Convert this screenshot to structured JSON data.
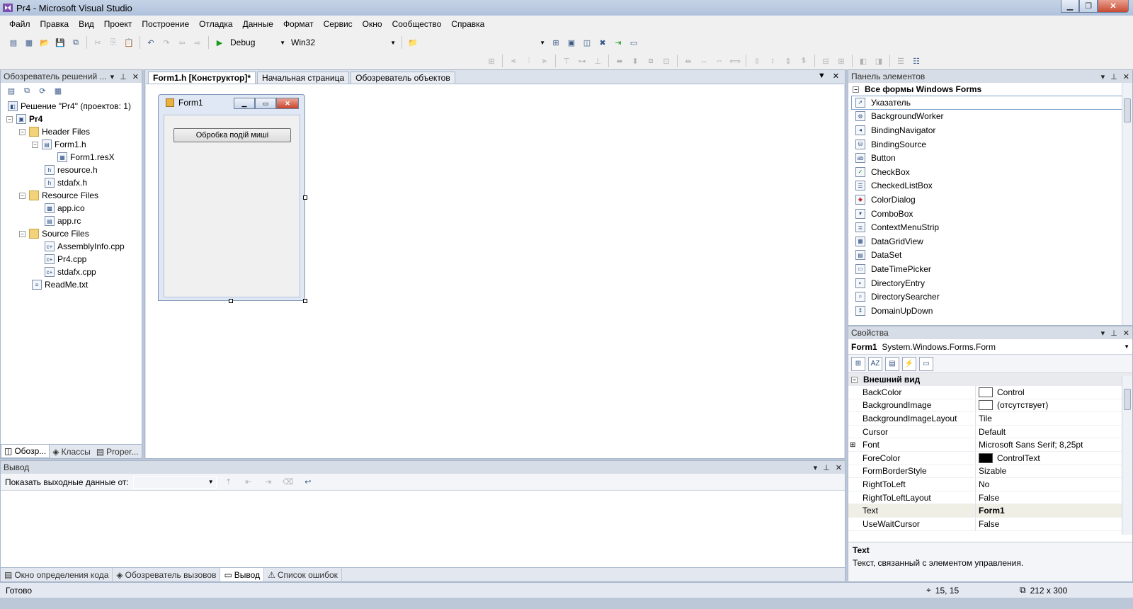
{
  "window": {
    "title": "Pr4 - Microsoft Visual Studio"
  },
  "menu": [
    "Файл",
    "Правка",
    "Вид",
    "Проект",
    "Построение",
    "Отладка",
    "Данные",
    "Формат",
    "Сервис",
    "Окно",
    "Сообщество",
    "Справка"
  ],
  "toolbar": {
    "config": "Debug",
    "platform": "Win32"
  },
  "solution_explorer": {
    "title": "Обозреватель решений ...",
    "nodes": [
      {
        "label": "Решение \"Pr4\"  (проектов: 1)"
      },
      {
        "label": "Pr4"
      },
      {
        "label": "Header Files"
      },
      {
        "label": "Form1.h"
      },
      {
        "label": "Form1.resX"
      },
      {
        "label": "resource.h"
      },
      {
        "label": "stdafx.h"
      },
      {
        "label": "Resource Files"
      },
      {
        "label": "app.ico"
      },
      {
        "label": "app.rc"
      },
      {
        "label": "Source Files"
      },
      {
        "label": "AssemblyInfo.cpp"
      },
      {
        "label": "Pr4.cpp"
      },
      {
        "label": "stdafx.cpp"
      },
      {
        "label": "ReadMe.txt"
      }
    ],
    "tabs": [
      "Обозр...",
      "Классы",
      "Proper..."
    ]
  },
  "editor": {
    "tabs": [
      "Form1.h [Конструктор]*",
      "Начальная страница",
      "Обозреватель объектов"
    ],
    "form": {
      "title": "Form1",
      "button": "Обробка подій миші"
    }
  },
  "toolbox": {
    "title": "Панель элементов",
    "section": "Все формы Windows Forms",
    "items": [
      "Указатель",
      "BackgroundWorker",
      "BindingNavigator",
      "BindingSource",
      "Button",
      "CheckBox",
      "CheckedListBox",
      "ColorDialog",
      "ComboBox",
      "ContextMenuStrip",
      "DataGridView",
      "DataSet",
      "DateTimePicker",
      "DirectoryEntry",
      "DirectorySearcher",
      "DomainUpDown"
    ]
  },
  "properties": {
    "title": "Свойства",
    "object_name": "Form1",
    "object_type": "System.Windows.Forms.Form",
    "category": "Внешний вид",
    "rows": [
      {
        "name": "BackColor",
        "value": "Control",
        "swatch": "#ffffff"
      },
      {
        "name": "BackgroundImage",
        "value": "(отсутствует)",
        "swatch": "#ffffff"
      },
      {
        "name": "BackgroundImageLayout",
        "value": "Tile"
      },
      {
        "name": "Cursor",
        "value": "Default"
      },
      {
        "name": "Font",
        "value": "Microsoft Sans Serif; 8,25pt",
        "expandable": true
      },
      {
        "name": "ForeColor",
        "value": "ControlText",
        "swatch": "#000000"
      },
      {
        "name": "FormBorderStyle",
        "value": "Sizable"
      },
      {
        "name": "RightToLeft",
        "value": "No"
      },
      {
        "name": "RightToLeftLayout",
        "value": "False"
      },
      {
        "name": "Text",
        "value": "Form1",
        "bold": true
      },
      {
        "name": "UseWaitCursor",
        "value": "False"
      }
    ],
    "desc_title": "Text",
    "desc_text": "Текст, связанный с элементом управления."
  },
  "output": {
    "title": "Вывод",
    "show_label": "Показать выходные данные от:",
    "tabs": [
      "Окно определения кода",
      "Обозреватель вызовов",
      "Вывод",
      "Список ошибок"
    ]
  },
  "status": {
    "text": "Готово",
    "position": "15, 15",
    "size": "212 x 300"
  }
}
